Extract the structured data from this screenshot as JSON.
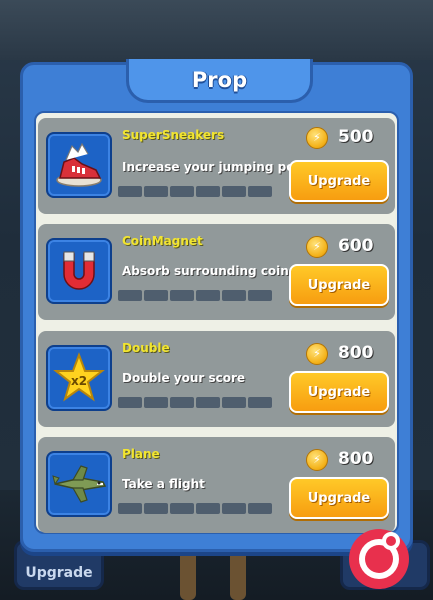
{
  "panel": {
    "title": "Prop"
  },
  "items": [
    {
      "name": "SuperSneakers",
      "description": "Increase your jumping power",
      "price": "500",
      "button": "Upgrade",
      "level": 0,
      "max_level": 6,
      "icon": "sneaker-icon"
    },
    {
      "name": "CoinMagnet",
      "description": "Absorb surrounding coins",
      "price": "600",
      "button": "Upgrade",
      "level": 0,
      "max_level": 6,
      "icon": "magnet-icon"
    },
    {
      "name": "Double",
      "description": "Double your score",
      "price": "800",
      "button": "Upgrade",
      "level": 0,
      "max_level": 6,
      "icon": "star-x2-icon",
      "badge": "x2"
    },
    {
      "name": "Plane",
      "description": "Take a flight",
      "price": "800",
      "button": "Upgrade",
      "level": 0,
      "max_level": 6,
      "icon": "plane-icon"
    }
  ],
  "background": {
    "left_button": "Upgrade"
  },
  "colors": {
    "panel": "#3e7fd6",
    "button": "#f9b21c",
    "name_text": "#f2e530"
  }
}
